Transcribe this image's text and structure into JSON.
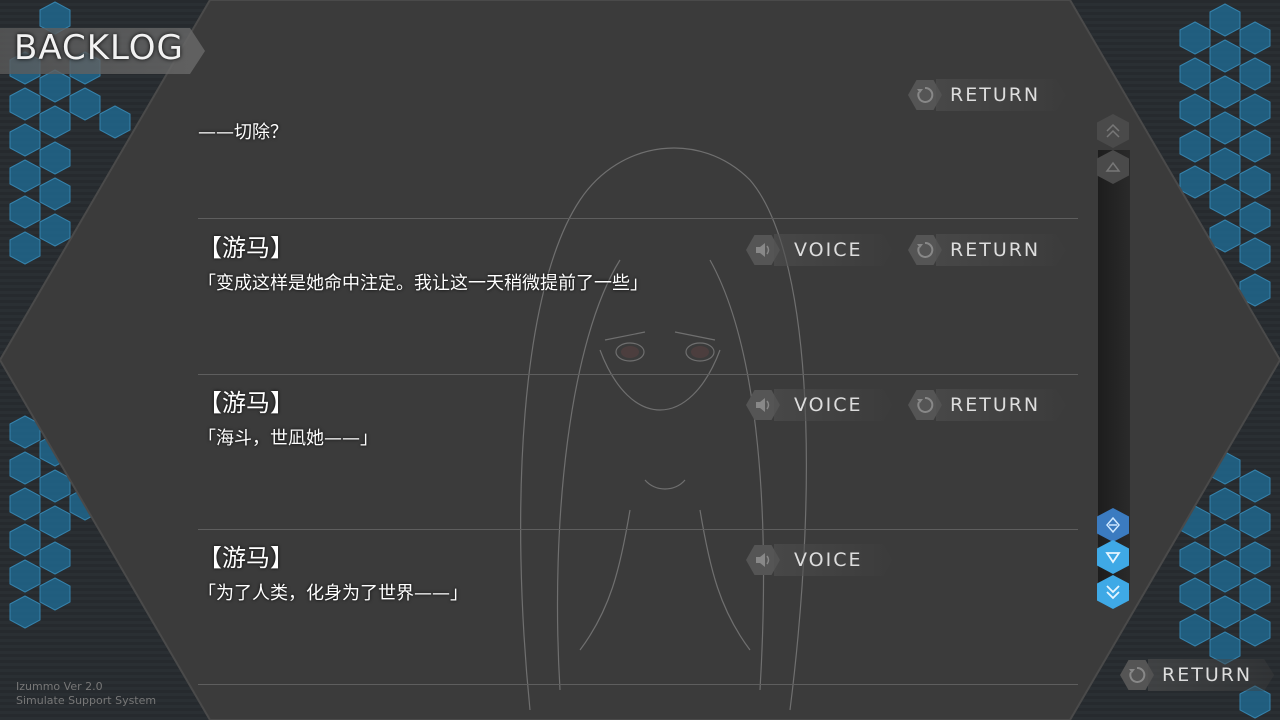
{
  "header": {
    "title": "BACKLOG"
  },
  "footer": {
    "version_line1": "Izummo Ver 2.0",
    "version_line2": "Simulate Support System"
  },
  "entries": [
    {
      "speaker": "",
      "text": "——切除？",
      "has_voice": false,
      "has_return": true
    },
    {
      "speaker": "【游马】",
      "text": "「变成这样是她命中注定。我让这一天稍微提前了一些」",
      "has_voice": true,
      "has_return": true
    },
    {
      "speaker": "【游马】",
      "text": "「海斗，世凪她——」",
      "has_voice": true,
      "has_return": true
    },
    {
      "speaker": "【游马】",
      "text": "「为了人类，化身为了世界——」",
      "has_voice": true,
      "has_return": false
    }
  ],
  "buttons": {
    "voice_label": "VOICE",
    "return_label": "RETURN",
    "main_return_label": "RETURN"
  },
  "colors": {
    "accent": "#3fa9e6",
    "hex_blue": "#1e6e9c",
    "panel": "#3a3a3a"
  },
  "icons": {
    "voice": "speaker-icon",
    "return": "return-arrow-icon",
    "scroll_top": "double-up-icon",
    "scroll_up": "up-icon",
    "scroll_latest": "jump-icon",
    "scroll_down": "down-icon",
    "scroll_bottom": "double-down-icon"
  }
}
